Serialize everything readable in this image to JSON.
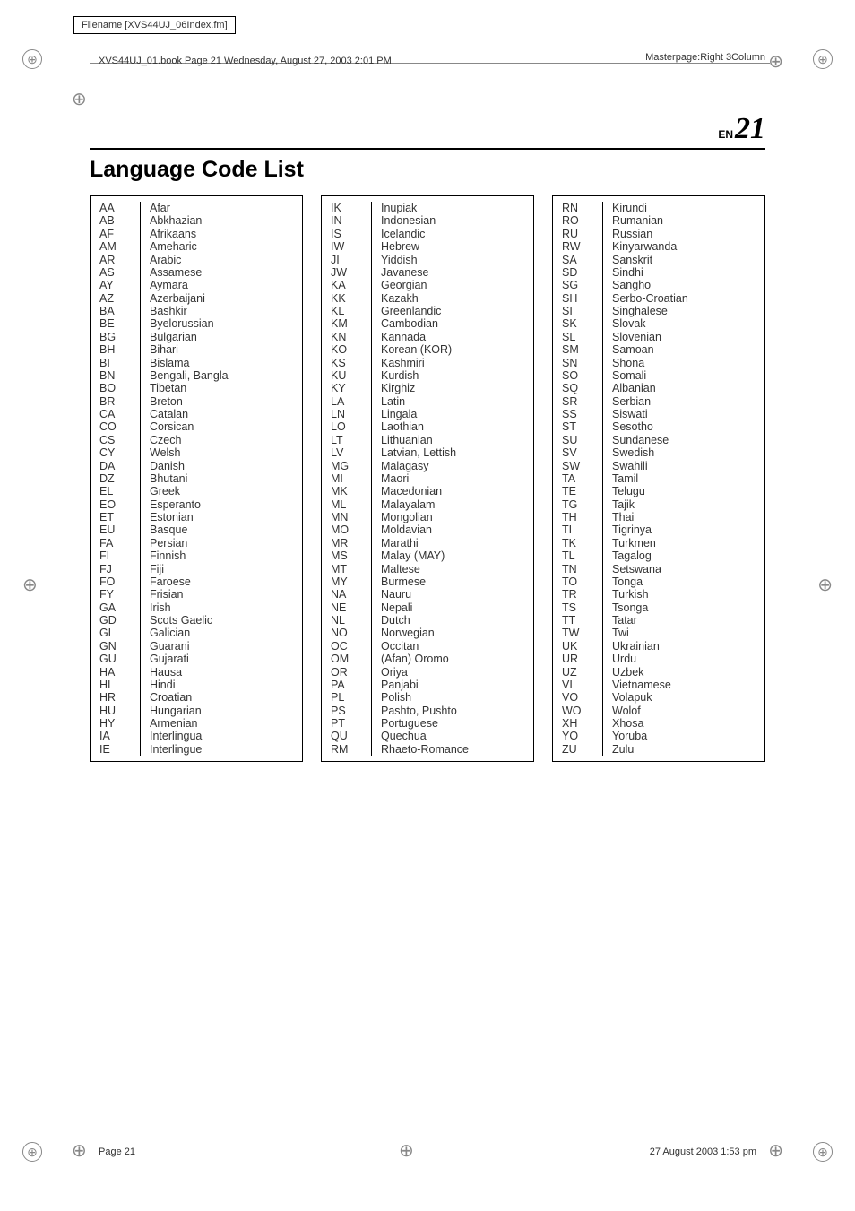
{
  "filename": "Filename [XVS44UJ_06Index.fm]",
  "book_info": "XVS44UJ_01.book  Page 21  Wednesday, August 27, 2003  2:01 PM",
  "masterpage": "Masterpage:Right 3Column",
  "page_lang": "EN",
  "page_number": "21",
  "title": "Language Code List",
  "footer_left": "Page 21",
  "footer_right": "27 August 2003 1:53 pm",
  "columns": [
    [
      {
        "code": "AA",
        "name": "Afar"
      },
      {
        "code": "AB",
        "name": "Abkhazian"
      },
      {
        "code": "AF",
        "name": "Afrikaans"
      },
      {
        "code": "AM",
        "name": "Ameharic"
      },
      {
        "code": "AR",
        "name": "Arabic"
      },
      {
        "code": "AS",
        "name": "Assamese"
      },
      {
        "code": "AY",
        "name": "Aymara"
      },
      {
        "code": "AZ",
        "name": "Azerbaijani"
      },
      {
        "code": "BA",
        "name": "Bashkir"
      },
      {
        "code": "BE",
        "name": "Byelorussian"
      },
      {
        "code": "BG",
        "name": "Bulgarian"
      },
      {
        "code": "BH",
        "name": "Bihari"
      },
      {
        "code": "BI",
        "name": "Bislama"
      },
      {
        "code": "BN",
        "name": "Bengali, Bangla"
      },
      {
        "code": "BO",
        "name": "Tibetan"
      },
      {
        "code": "BR",
        "name": "Breton"
      },
      {
        "code": "CA",
        "name": "Catalan"
      },
      {
        "code": "CO",
        "name": "Corsican"
      },
      {
        "code": "CS",
        "name": "Czech"
      },
      {
        "code": "CY",
        "name": "Welsh"
      },
      {
        "code": "DA",
        "name": "Danish"
      },
      {
        "code": "DZ",
        "name": "Bhutani"
      },
      {
        "code": "EL",
        "name": "Greek"
      },
      {
        "code": "EO",
        "name": "Esperanto"
      },
      {
        "code": "ET",
        "name": "Estonian"
      },
      {
        "code": "EU",
        "name": "Basque"
      },
      {
        "code": "FA",
        "name": "Persian"
      },
      {
        "code": "FI",
        "name": "Finnish"
      },
      {
        "code": "FJ",
        "name": "Fiji"
      },
      {
        "code": "FO",
        "name": "Faroese"
      },
      {
        "code": "FY",
        "name": "Frisian"
      },
      {
        "code": "GA",
        "name": "Irish"
      },
      {
        "code": "GD",
        "name": "Scots Gaelic"
      },
      {
        "code": "GL",
        "name": "Galician"
      },
      {
        "code": "GN",
        "name": "Guarani"
      },
      {
        "code": "GU",
        "name": "Gujarati"
      },
      {
        "code": "HA",
        "name": "Hausa"
      },
      {
        "code": "HI",
        "name": "Hindi"
      },
      {
        "code": "HR",
        "name": "Croatian"
      },
      {
        "code": "HU",
        "name": "Hungarian"
      },
      {
        "code": "HY",
        "name": "Armenian"
      },
      {
        "code": "IA",
        "name": "Interlingua"
      },
      {
        "code": "IE",
        "name": "Interlingue"
      }
    ],
    [
      {
        "code": "IK",
        "name": "Inupiak"
      },
      {
        "code": "IN",
        "name": "Indonesian"
      },
      {
        "code": "IS",
        "name": "Icelandic"
      },
      {
        "code": "IW",
        "name": "Hebrew"
      },
      {
        "code": "JI",
        "name": "Yiddish"
      },
      {
        "code": "JW",
        "name": "Javanese"
      },
      {
        "code": "KA",
        "name": "Georgian"
      },
      {
        "code": "KK",
        "name": "Kazakh"
      },
      {
        "code": "KL",
        "name": "Greenlandic"
      },
      {
        "code": "KM",
        "name": "Cambodian"
      },
      {
        "code": "KN",
        "name": "Kannada"
      },
      {
        "code": "KO",
        "name": "Korean (KOR)"
      },
      {
        "code": "KS",
        "name": "Kashmiri"
      },
      {
        "code": "KU",
        "name": "Kurdish"
      },
      {
        "code": "KY",
        "name": "Kirghiz"
      },
      {
        "code": "LA",
        "name": "Latin"
      },
      {
        "code": "LN",
        "name": "Lingala"
      },
      {
        "code": "LO",
        "name": "Laothian"
      },
      {
        "code": "LT",
        "name": "Lithuanian"
      },
      {
        "code": "LV",
        "name": "Latvian, Lettish"
      },
      {
        "code": "MG",
        "name": "Malagasy"
      },
      {
        "code": "MI",
        "name": "Maori"
      },
      {
        "code": "MK",
        "name": "Macedonian"
      },
      {
        "code": "ML",
        "name": "Malayalam"
      },
      {
        "code": "MN",
        "name": "Mongolian"
      },
      {
        "code": "MO",
        "name": "Moldavian"
      },
      {
        "code": "MR",
        "name": "Marathi"
      },
      {
        "code": "MS",
        "name": "Malay (MAY)"
      },
      {
        "code": "MT",
        "name": "Maltese"
      },
      {
        "code": "MY",
        "name": "Burmese"
      },
      {
        "code": "NA",
        "name": "Nauru"
      },
      {
        "code": "NE",
        "name": "Nepali"
      },
      {
        "code": "NL",
        "name": "Dutch"
      },
      {
        "code": "NO",
        "name": "Norwegian"
      },
      {
        "code": "OC",
        "name": "Occitan"
      },
      {
        "code": "OM",
        "name": "(Afan) Oromo"
      },
      {
        "code": "OR",
        "name": "Oriya"
      },
      {
        "code": "PA",
        "name": "Panjabi"
      },
      {
        "code": "PL",
        "name": "Polish"
      },
      {
        "code": "PS",
        "name": "Pashto, Pushto"
      },
      {
        "code": "PT",
        "name": "Portuguese"
      },
      {
        "code": "QU",
        "name": "Quechua"
      },
      {
        "code": "RM",
        "name": "Rhaeto-Romance"
      }
    ],
    [
      {
        "code": "RN",
        "name": "Kirundi"
      },
      {
        "code": "RO",
        "name": "Rumanian"
      },
      {
        "code": "RU",
        "name": "Russian"
      },
      {
        "code": "RW",
        "name": "Kinyarwanda"
      },
      {
        "code": "SA",
        "name": "Sanskrit"
      },
      {
        "code": "SD",
        "name": "Sindhi"
      },
      {
        "code": "SG",
        "name": "Sangho"
      },
      {
        "code": "SH",
        "name": "Serbo-Croatian"
      },
      {
        "code": "SI",
        "name": "Singhalese"
      },
      {
        "code": "SK",
        "name": "Slovak"
      },
      {
        "code": "SL",
        "name": "Slovenian"
      },
      {
        "code": "SM",
        "name": "Samoan"
      },
      {
        "code": "SN",
        "name": "Shona"
      },
      {
        "code": "SO",
        "name": "Somali"
      },
      {
        "code": "SQ",
        "name": "Albanian"
      },
      {
        "code": "SR",
        "name": "Serbian"
      },
      {
        "code": "SS",
        "name": "Siswati"
      },
      {
        "code": "ST",
        "name": "Sesotho"
      },
      {
        "code": "SU",
        "name": "Sundanese"
      },
      {
        "code": "SV",
        "name": "Swedish"
      },
      {
        "code": "SW",
        "name": "Swahili"
      },
      {
        "code": "TA",
        "name": "Tamil"
      },
      {
        "code": "TE",
        "name": "Telugu"
      },
      {
        "code": "TG",
        "name": "Tajik"
      },
      {
        "code": "TH",
        "name": "Thai"
      },
      {
        "code": "TI",
        "name": "Tigrinya"
      },
      {
        "code": "TK",
        "name": "Turkmen"
      },
      {
        "code": "TL",
        "name": "Tagalog"
      },
      {
        "code": "TN",
        "name": "Setswana"
      },
      {
        "code": "TO",
        "name": "Tonga"
      },
      {
        "code": "TR",
        "name": "Turkish"
      },
      {
        "code": "TS",
        "name": "Tsonga"
      },
      {
        "code": "TT",
        "name": "Tatar"
      },
      {
        "code": "TW",
        "name": "Twi"
      },
      {
        "code": "UK",
        "name": "Ukrainian"
      },
      {
        "code": "UR",
        "name": "Urdu"
      },
      {
        "code": "UZ",
        "name": "Uzbek"
      },
      {
        "code": "VI",
        "name": "Vietnamese"
      },
      {
        "code": "VO",
        "name": "Volapuk"
      },
      {
        "code": "WO",
        "name": "Wolof"
      },
      {
        "code": "XH",
        "name": "Xhosa"
      },
      {
        "code": "YO",
        "name": "Yoruba"
      },
      {
        "code": "ZU",
        "name": "Zulu"
      }
    ]
  ]
}
